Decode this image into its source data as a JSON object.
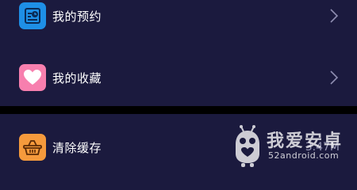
{
  "menu": {
    "appointments": {
      "label": "我的预约",
      "icon": "calendar-clock-icon",
      "icon_color": "#1e8fe6"
    },
    "favorites": {
      "label": "我的收藏",
      "icon": "heart-icon",
      "icon_color": "#f77fae"
    },
    "cache": {
      "label": "清除缓存",
      "icon": "basket-icon",
      "icon_color": "#f59a3c",
      "value": "3.47M"
    }
  },
  "watermark": {
    "title": "我爱安卓",
    "url": "52android.com",
    "icon": "android-mascot-icon"
  },
  "colors": {
    "background": "#1b1a3e",
    "divider": "#000000",
    "text": "#ffffff",
    "chevron": "#8e8db0"
  }
}
